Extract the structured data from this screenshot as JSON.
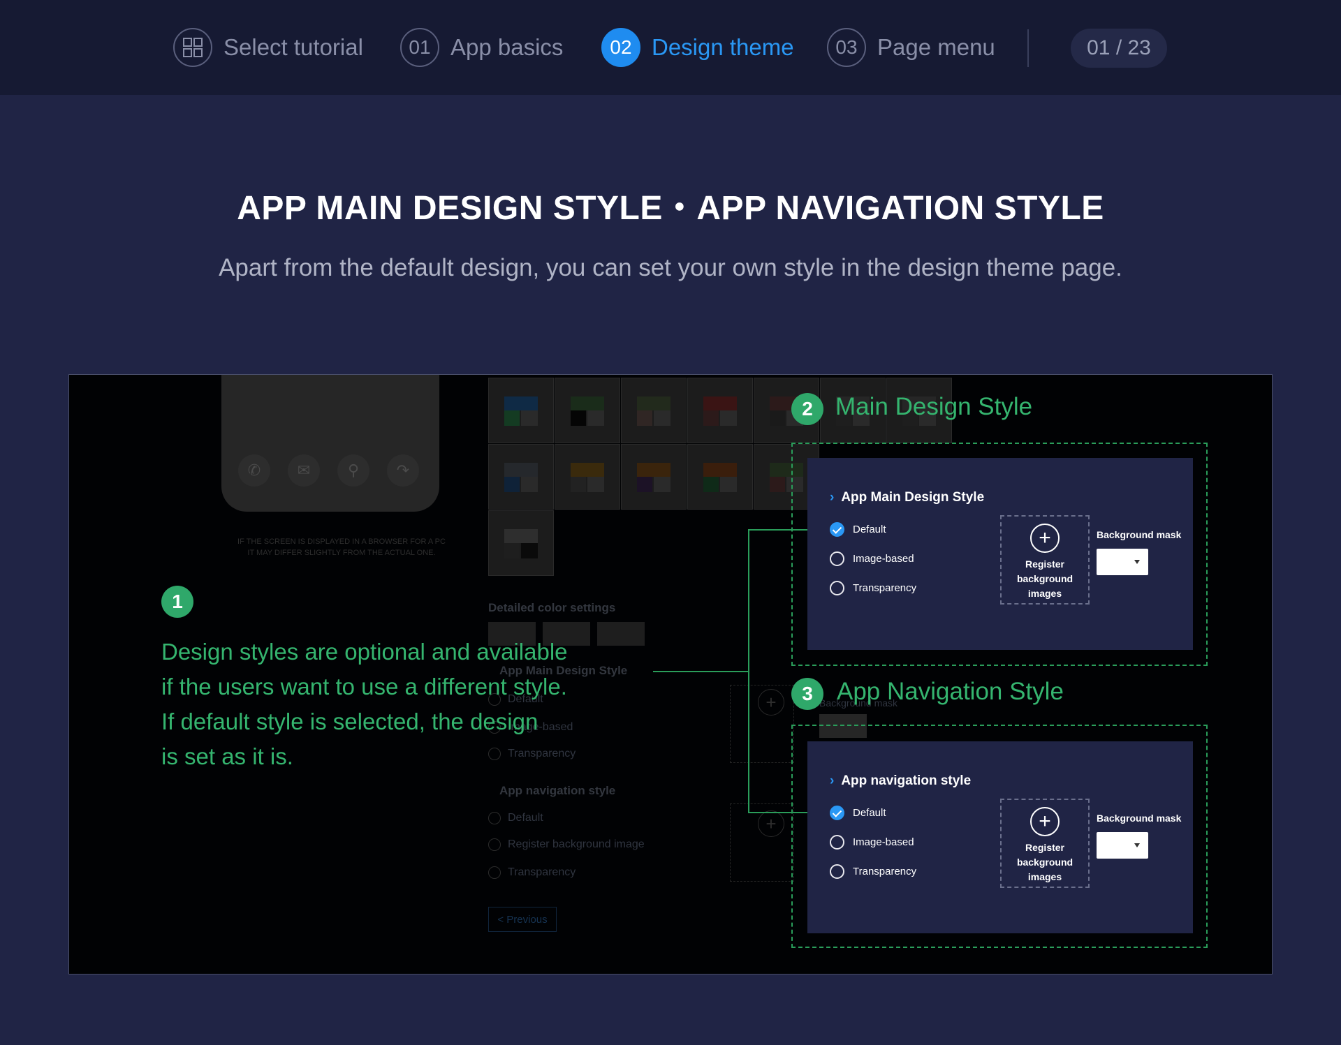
{
  "nav": {
    "steps": [
      {
        "number": "",
        "label": "Select tutorial",
        "icon": "grid-icon"
      },
      {
        "number": "01",
        "label": "App basics"
      },
      {
        "number": "02",
        "label": "Design theme",
        "active": true
      },
      {
        "number": "03",
        "label": "Page menu"
      }
    ],
    "counter": "01 / 23"
  },
  "header": {
    "title": "APP MAIN DESIGN STYLE・APP NAVIGATION STYLE",
    "subtitle": "Apart from the default design, you can set your own style in the design theme page."
  },
  "colors": {
    "accent": "#1f8cf0",
    "annotation": "#35b56f",
    "background": "#202445",
    "nav_bg": "#161a33"
  },
  "background_ui": {
    "phone_icons": [
      "phone-icon",
      "mail-icon",
      "location-icon",
      "share-icon"
    ],
    "notice_line1": "IF THE SCREEN IS DISPLAYED IN A BROWSER FOR A PC",
    "notice_line2": "IT MAY DIFFER SLIGHTLY FROM THE ACTUAL ONE.",
    "detailed_color_settings": "Detailed color settings",
    "main_style_heading": "App Main Design Style",
    "main_options": [
      "Default",
      "Image-based",
      "Transparency"
    ],
    "nav_style_heading": "App navigation style",
    "nav_options": [
      "Default",
      "Register background image",
      "Transparency"
    ],
    "register_text": [
      "Register",
      "background",
      "images"
    ],
    "mask_label": "Background mask",
    "previous_button": "< Previous"
  },
  "annotations": {
    "one": {
      "badge": "1",
      "lines": [
        "Design styles are optional and available",
        "if the users want to use a different style.",
        "If default style is selected, the design",
        "is set as it is."
      ]
    },
    "two": {
      "badge": "2",
      "title": "Main Design Style"
    },
    "three": {
      "badge": "3",
      "title": "App Navigation Style"
    }
  },
  "main_card": {
    "heading": "App Main Design Style",
    "options": [
      "Default",
      "Image-based",
      "Transparency"
    ],
    "selected": 0,
    "register": [
      "Register",
      "background",
      "images"
    ],
    "mask_label": "Background mask"
  },
  "nav_card": {
    "heading": "App navigation style",
    "options": [
      "Default",
      "Image-based",
      "Transparency"
    ],
    "selected": 0,
    "register": [
      "Register",
      "background",
      "images"
    ],
    "mask_label": "Background mask"
  }
}
